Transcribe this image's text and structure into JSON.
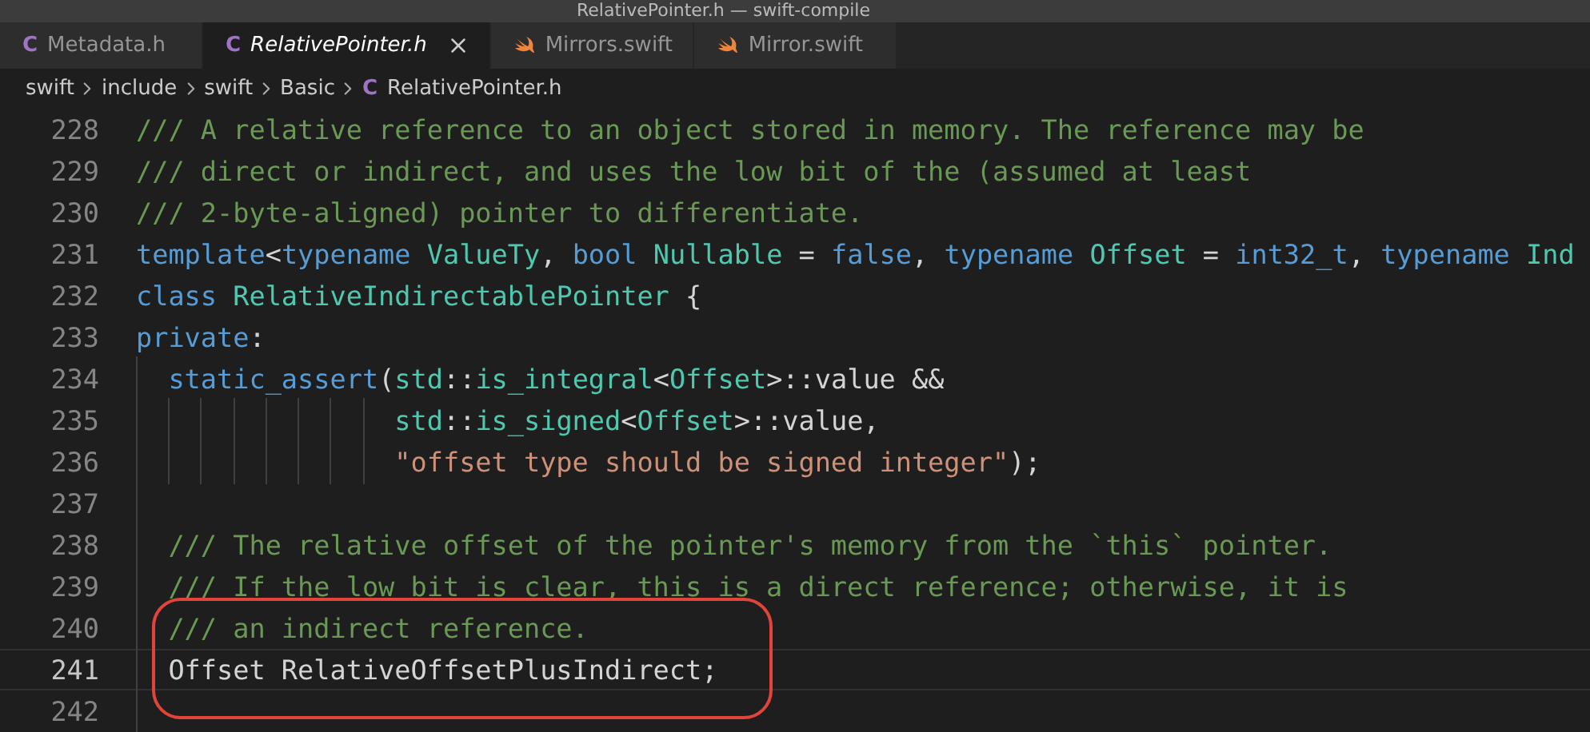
{
  "window": {
    "title": "RelativePointer.h — swift-compile"
  },
  "tabs": [
    {
      "label": "Metadata.h",
      "kind": "header",
      "icon_text": "C",
      "selected": false,
      "preview": false
    },
    {
      "label": "RelativePointer.h",
      "kind": "header",
      "icon_text": "C",
      "selected": true,
      "preview": true
    },
    {
      "label": "Mirrors.swift",
      "kind": "swift",
      "selected": false,
      "preview": false
    },
    {
      "label": "Mirror.swift",
      "kind": "swift",
      "selected": false,
      "preview": false
    }
  ],
  "breadcrumbs": [
    {
      "label": "swift",
      "kind": "folder"
    },
    {
      "label": "include",
      "kind": "folder"
    },
    {
      "label": "swift",
      "kind": "folder"
    },
    {
      "label": "Basic",
      "kind": "folder"
    },
    {
      "label": "RelativePointer.h",
      "kind": "header",
      "icon_text": "C"
    }
  ],
  "editor": {
    "lines": [
      {
        "number": "228",
        "current": false,
        "tokens": [
          {
            "text": "/// A relative reference to an object stored in memory. The reference may be",
            "kind": "comment"
          }
        ]
      },
      {
        "number": "229",
        "current": false,
        "tokens": [
          {
            "text": "/// direct or indirect, and uses the low bit of the (assumed at least",
            "kind": "comment"
          }
        ]
      },
      {
        "number": "230",
        "current": false,
        "tokens": [
          {
            "text": "/// 2-byte-aligned) pointer to differentiate.",
            "kind": "comment"
          }
        ]
      },
      {
        "number": "231",
        "current": false,
        "tokens": [
          {
            "text": "template",
            "kind": "keyword"
          },
          {
            "text": "<",
            "kind": "plain"
          },
          {
            "text": "typename ",
            "kind": "keyword"
          },
          {
            "text": "ValueTy",
            "kind": "type"
          },
          {
            "text": ", ",
            "kind": "plain"
          },
          {
            "text": "bool ",
            "kind": "keyword"
          },
          {
            "text": "Nullable",
            "kind": "type"
          },
          {
            "text": " = ",
            "kind": "plain"
          },
          {
            "text": "false",
            "kind": "keyword"
          },
          {
            "text": ", ",
            "kind": "plain"
          },
          {
            "text": "typename ",
            "kind": "keyword"
          },
          {
            "text": "Offset",
            "kind": "type"
          },
          {
            "text": " = ",
            "kind": "plain"
          },
          {
            "text": "int32_t",
            "kind": "keyword"
          },
          {
            "text": ", ",
            "kind": "plain"
          },
          {
            "text": "typename ",
            "kind": "keyword"
          },
          {
            "text": "Ind",
            "kind": "type"
          }
        ]
      },
      {
        "number": "232",
        "current": false,
        "tokens": [
          {
            "text": "class ",
            "kind": "keyword"
          },
          {
            "text": "RelativeIndirectablePointer",
            "kind": "type"
          },
          {
            "text": " {",
            "kind": "plain"
          }
        ]
      },
      {
        "number": "233",
        "current": false,
        "tokens": [
          {
            "text": "private",
            "kind": "keyword"
          },
          {
            "text": ":",
            "kind": "plain"
          }
        ]
      },
      {
        "number": "234",
        "current": false,
        "tokens": [
          {
            "text": "  static_assert",
            "kind": "keyword"
          },
          {
            "text": "(",
            "kind": "plain"
          },
          {
            "text": "std",
            "kind": "type"
          },
          {
            "text": "::",
            "kind": "plain"
          },
          {
            "text": "is_integral",
            "kind": "type"
          },
          {
            "text": "<",
            "kind": "plain"
          },
          {
            "text": "Offset",
            "kind": "type"
          },
          {
            "text": ">::value &&",
            "kind": "plain"
          }
        ]
      },
      {
        "number": "235",
        "current": false,
        "tokens": [
          {
            "text": "                std",
            "kind": "type"
          },
          {
            "text": "::",
            "kind": "plain"
          },
          {
            "text": "is_signed",
            "kind": "type"
          },
          {
            "text": "<",
            "kind": "plain"
          },
          {
            "text": "Offset",
            "kind": "type"
          },
          {
            "text": ">::value,",
            "kind": "plain"
          }
        ]
      },
      {
        "number": "236",
        "current": false,
        "tokens": [
          {
            "text": "                \"offset type should be signed integer\"",
            "kind": "string"
          },
          {
            "text": ");",
            "kind": "plain"
          }
        ]
      },
      {
        "number": "237",
        "current": false
      },
      {
        "number": "238",
        "current": false,
        "tokens": [
          {
            "text": "  /// The relative offset of the pointer's memory from the `this` pointer.",
            "kind": "comment"
          }
        ]
      },
      {
        "number": "239",
        "current": false,
        "tokens": [
          {
            "text": "  /// If the low bit is clear, this is a direct reference; otherwise, it is",
            "kind": "comment"
          }
        ]
      },
      {
        "number": "240",
        "current": false,
        "tokens": [
          {
            "text": "  /// an indirect reference.",
            "kind": "comment"
          }
        ]
      },
      {
        "number": "241",
        "current": true,
        "tokens": [
          {
            "text": "  Offset RelativeOffsetPlusIndirect;",
            "kind": "plain"
          }
        ]
      },
      {
        "number": "242",
        "current": false
      }
    ]
  }
}
